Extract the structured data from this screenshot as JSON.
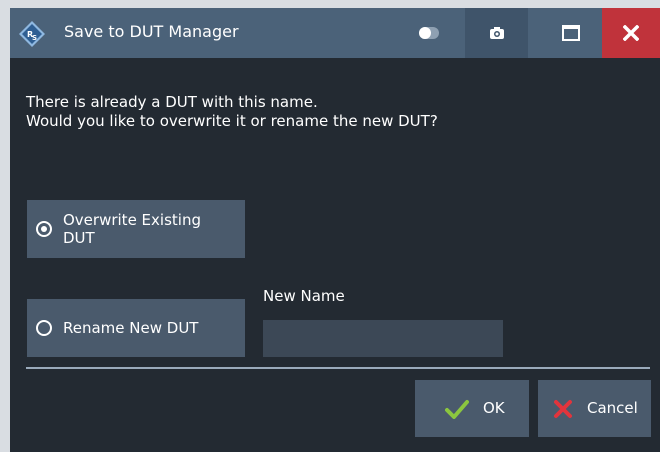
{
  "window": {
    "title": "Save to DUT Manager"
  },
  "titlebar_icons": [
    "app-logo-icon",
    "toggle-icon",
    "camera-icon",
    "maximize-icon",
    "close-icon"
  ],
  "message": {
    "line1": "There is already a DUT with this name.",
    "line2": "Would you like to overwrite it or rename the new DUT?"
  },
  "options": {
    "overwrite": {
      "label": "Overwrite Existing DUT",
      "selected": true
    },
    "rename": {
      "label": "Rename New DUT",
      "selected": false
    }
  },
  "new_name": {
    "label": "New Name",
    "value": ""
  },
  "buttons": {
    "ok": "OK",
    "cancel": "Cancel"
  },
  "colors": {
    "titlebar": "#4b6279",
    "background": "#232a32",
    "button": "#4a5a6c",
    "close": "#c0333b",
    "ok_check": "#8bc63f",
    "cancel_x": "#e2343c"
  }
}
